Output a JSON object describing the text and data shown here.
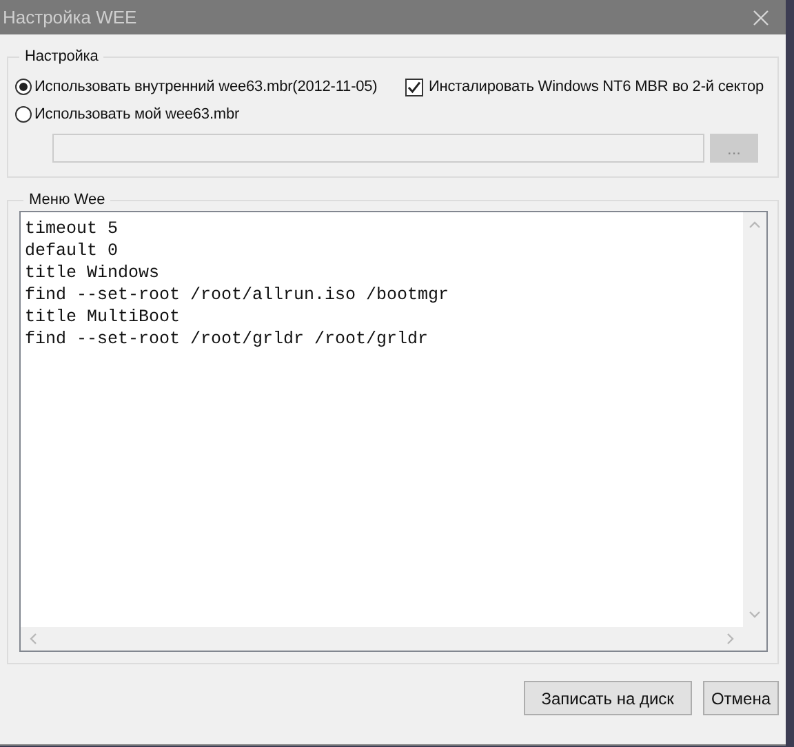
{
  "window": {
    "title": "Настройка WEE"
  },
  "settings": {
    "title": "Настройка",
    "options": [
      {
        "label": "Использовать внутренний wee63.mbr(2012-11-05)",
        "selected": true
      },
      {
        "label": "Использовать мой wee63.mbr",
        "selected": false
      }
    ],
    "install_nt6": {
      "label": "Инсталировать Windows NT6 MBR во 2-й сектор",
      "checked": true
    },
    "path_field": {
      "disabled": true
    },
    "browse_button": {
      "label": "...",
      "disabled": true
    }
  },
  "menu": {
    "title": "Меню Wee",
    "lines": [
      "timeout 5",
      "default 0",
      "title Windows",
      "find --set-root /root/allrun.iso /bootmgr",
      "title MultiBoot",
      "find --set-root /root/grldr /root/grldr"
    ]
  },
  "buttons": [
    {
      "label": "Записать на диск"
    },
    {
      "label": "Отмена"
    }
  ]
}
